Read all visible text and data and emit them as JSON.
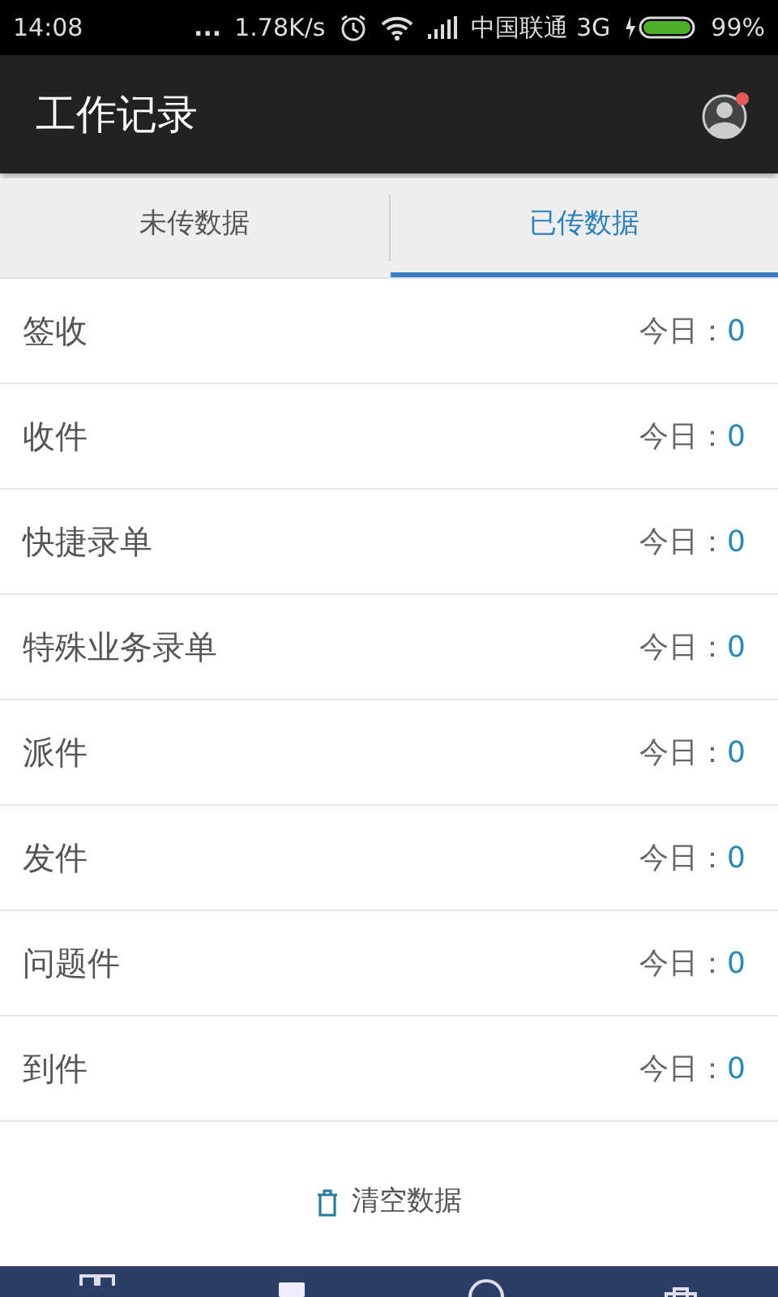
{
  "status_bar": {
    "time": "14:08",
    "dots": "...",
    "speed": "1.78K/s",
    "carrier": "中国联通 3G",
    "battery": "99%"
  },
  "header": {
    "title": "工作记录",
    "notification": true
  },
  "tabs": [
    {
      "label": "未传数据",
      "selected": false
    },
    {
      "label": "已传数据",
      "selected": true
    }
  ],
  "rows": [
    {
      "name": "签收",
      "label": "今日：",
      "count": "0"
    },
    {
      "name": "收件",
      "label": "今日：",
      "count": "0"
    },
    {
      "name": "快捷录单",
      "label": "今日：",
      "count": "0"
    },
    {
      "name": "特殊业务录单",
      "label": "今日：",
      "count": "0"
    },
    {
      "name": "派件",
      "label": "今日：",
      "count": "0"
    },
    {
      "name": "发件",
      "label": "今日：",
      "count": "0"
    },
    {
      "name": "问题件",
      "label": "今日：",
      "count": "0"
    },
    {
      "name": "到件",
      "label": "今日：",
      "count": "0"
    }
  ],
  "clear_button": {
    "label": "清空数据"
  }
}
